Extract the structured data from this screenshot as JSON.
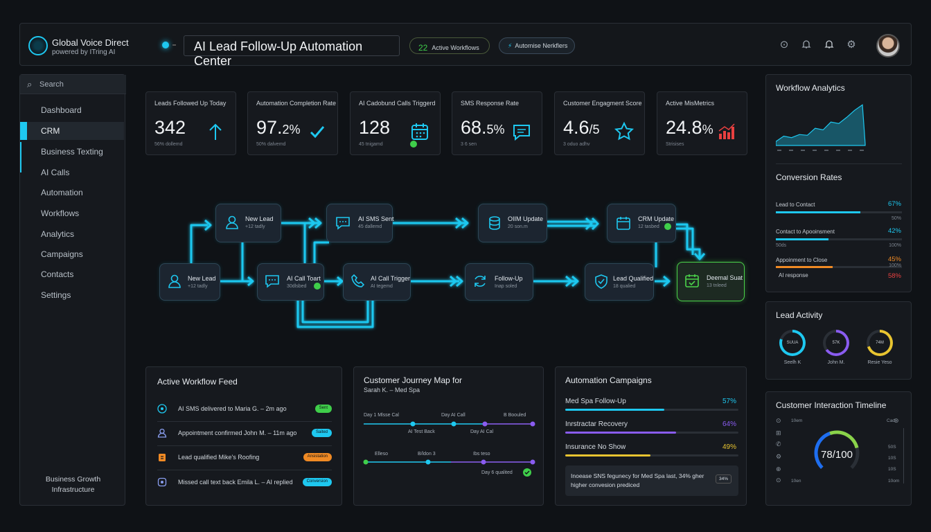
{
  "header": {
    "brand_name": "Global Voice Direct",
    "brand_sub": "powered by ITring AI",
    "title": "AI Lead Follow-Up Automation Center",
    "pill1_count": "22",
    "pill1_label": "Active Workflows",
    "pill2_label": "Automise Nerkflers",
    "icons": [
      "help-icon",
      "bell-icon",
      "notification-icon",
      "settings-icon"
    ]
  },
  "sidebar": {
    "search_placeholder": "Search",
    "items": [
      "Dashboard",
      "CRM",
      "Business Texting",
      "AI Calls",
      "Automation",
      "Workflows",
      "Analytics",
      "Campaigns",
      "Contacts",
      "Settings"
    ],
    "active": "CRM",
    "footer_line1": "Business Growth",
    "footer_line2": "Infrastructure"
  },
  "metrics": [
    {
      "label": "Leads Followed Up Today",
      "value": "342",
      "unit": "",
      "sub": "56% dollemd",
      "icon": "arrow-up-icon"
    },
    {
      "label": "Automation Completion Rate",
      "value": "97.",
      "unit": "2%",
      "sub": "50% dalvemd",
      "icon": "check-icon"
    },
    {
      "label": "AI Cadobund Calls Triggerd",
      "value": "128",
      "unit": "",
      "sub": "45 tnigamd",
      "icon": "calendar-icon"
    },
    {
      "label": "SMS Response Rate",
      "value": "68.",
      "unit": "5%",
      "sub": "3 6 sen",
      "icon": "message-icon"
    },
    {
      "label": "Customer Engagment Score",
      "value": "4.6",
      "unit": "/5",
      "sub": "3 oduo adhv",
      "icon": "star-icon"
    },
    {
      "label": "Active MisMetrics",
      "value": "24.8",
      "unit": "%",
      "sub": "Strisises",
      "icon": "bar-chart-icon"
    }
  ],
  "workflow": {
    "nodes": [
      {
        "title": "New Lead",
        "sub": "+12 tadly"
      },
      {
        "title": "New Lead",
        "sub": "+12 tadly"
      },
      {
        "title": "AI SMS Sent",
        "sub": "45 dallemd"
      },
      {
        "title": "OIIM Update",
        "sub": "20 son.m"
      },
      {
        "title": "CRM Update",
        "sub": "12 tasbed"
      },
      {
        "title": "AI Call Toart",
        "sub": "30dlsbed"
      },
      {
        "title": "AI Call Trigger",
        "sub": "AI tegemd"
      },
      {
        "title": "Follow-Up",
        "sub": "Inap soled"
      },
      {
        "title": "Lead Qualified",
        "sub": "18 qualied"
      },
      {
        "title": "Deemal Suat",
        "sub": "13 tnleed"
      }
    ]
  },
  "feed": {
    "title": "Active Workflow Feed",
    "rows": [
      {
        "text": "AI SMS delivered to Maria G. – 2m ago",
        "tag": "Sent",
        "color": "#3fce4a"
      },
      {
        "text": "Appointment confirmed John M. – 11m ago",
        "tag": "Saited",
        "color": "#1ec8f0"
      },
      {
        "text": "Lead qualified Mike's Roofing",
        "tag": "Ansistation",
        "color": "#f08a24"
      },
      {
        "text": "Missed call text back  Emila L. – AI replied",
        "tag": "Conversion",
        "color": "#1ec8f0"
      }
    ]
  },
  "journey": {
    "title": "Customer Journey Map for",
    "subtitle": "Sarah K. – Med Spa",
    "labels_top": [
      "Day 1  Mlsse Cal",
      "Day AI Call",
      "B  Boouled"
    ],
    "labels_mid": [
      "AI Test Back",
      "Day AI Cal"
    ],
    "labels_bottom": [
      "Elleso",
      "B/ldon 3",
      "Ibs teso"
    ],
    "label_end": "Day 6 qualited"
  },
  "campaigns": {
    "title": "Automation Campaigns",
    "items": [
      {
        "name": "Med Spa Follow-Up",
        "pct": "57%",
        "value": 57,
        "color": "#1ec8f0"
      },
      {
        "name": "Inrstractar Recovery",
        "pct": "64%",
        "value": 64,
        "color": "#8a5cf0"
      },
      {
        "name": "Insurance No Show",
        "pct": "49%",
        "value": 49,
        "color": "#e8c430"
      }
    ],
    "insight_line1": "Inoease SNS fegunecy for Med Spa last, 34% gher",
    "insight_line2": "higher convesion prediced",
    "insight_badge": "34%"
  },
  "analytics": {
    "title": "Workflow Analytics",
    "area_values": [
      5,
      12,
      10,
      14,
      13,
      22,
      20,
      30,
      28,
      36,
      45,
      52,
      2
    ],
    "conv_title": "Conversion Rates",
    "conv": [
      {
        "name": "Lead to Contact",
        "pct": "67%",
        "value": 67,
        "color": "#1ec8f0",
        "sub_right": "50%"
      },
      {
        "name": "Contact to Apooinsment",
        "pct": "42%",
        "value": 42,
        "color": "#1ec8f0",
        "sub_left": "50ds",
        "sub_right": "100%"
      },
      {
        "name": "Appoinment to Close",
        "pct": "45%",
        "value": 45,
        "color": "#f08a24",
        "sub_right": "100%"
      },
      {
        "name": "AI response",
        "pct": "58%",
        "value": 58,
        "color": "#e84040"
      }
    ]
  },
  "lead_activity": {
    "title": "Lead Activity",
    "rings": [
      {
        "value_label": "SUUA",
        "name": "Seelh K",
        "pct": 80,
        "color": "#1ec8f0"
      },
      {
        "value_label": "57K",
        "name": "John M.",
        "pct": 65,
        "color": "#8a5cf0"
      },
      {
        "value_label": "74M",
        "name": "Resie Yeso",
        "pct": 70,
        "color": "#e8c430"
      }
    ]
  },
  "timeline": {
    "title": "Customer Interaction Timeline",
    "score": "78/100",
    "score_value": 78,
    "left_labels": [
      "10em",
      "",
      "",
      "",
      "",
      "10en"
    ],
    "right_labels": [
      "Cad",
      "",
      "50S",
      "10S",
      "10S",
      "10om"
    ]
  }
}
